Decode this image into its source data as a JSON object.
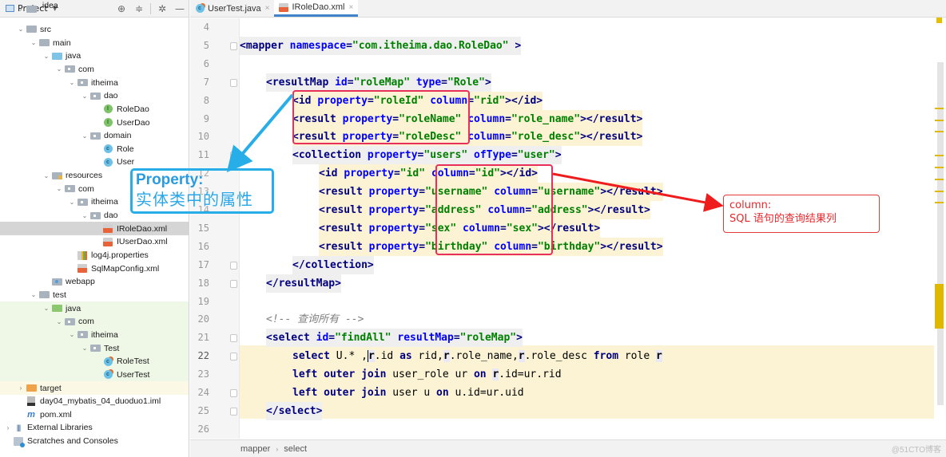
{
  "sidebar": {
    "title": "Project",
    "tools": [
      "locate-icon",
      "collapse-icon",
      "gear-icon",
      "minimize-icon"
    ],
    "tree": [
      {
        "label": ".idea",
        "type": "folder",
        "depth": 1,
        "arrow": "right",
        "partial": true
      },
      {
        "label": "src",
        "type": "folder",
        "depth": 1,
        "arrow": "down"
      },
      {
        "label": "main",
        "type": "folder",
        "depth": 2,
        "arrow": "down"
      },
      {
        "label": "java",
        "type": "src-folder",
        "depth": 3,
        "arrow": "down"
      },
      {
        "label": "com",
        "type": "package",
        "depth": 4,
        "arrow": "down"
      },
      {
        "label": "itheima",
        "type": "package",
        "depth": 5,
        "arrow": "down"
      },
      {
        "label": "dao",
        "type": "package",
        "depth": 6,
        "arrow": "down"
      },
      {
        "label": "RoleDao",
        "type": "interface",
        "depth": 7
      },
      {
        "label": "UserDao",
        "type": "interface",
        "depth": 7
      },
      {
        "label": "domain",
        "type": "package",
        "depth": 6,
        "arrow": "down"
      },
      {
        "label": "Role",
        "type": "class",
        "depth": 7
      },
      {
        "label": "User",
        "type": "class",
        "depth": 7
      },
      {
        "label": "resources",
        "type": "resources-folder",
        "depth": 3,
        "arrow": "down"
      },
      {
        "label": "com",
        "type": "package",
        "depth": 4,
        "arrow": "down"
      },
      {
        "label": "itheima",
        "type": "package",
        "depth": 5,
        "arrow": "down"
      },
      {
        "label": "dao",
        "type": "package",
        "depth": 6,
        "arrow": "down"
      },
      {
        "label": "IRoleDao.xml",
        "type": "xml",
        "depth": 7,
        "selected": true
      },
      {
        "label": "IUserDao.xml",
        "type": "xml",
        "depth": 7
      },
      {
        "label": "log4j.properties",
        "type": "properties",
        "depth": 5
      },
      {
        "label": "SqlMapConfig.xml",
        "type": "xml",
        "depth": 5
      },
      {
        "label": "webapp",
        "type": "web-folder",
        "depth": 3
      },
      {
        "label": "test",
        "type": "folder",
        "depth": 2,
        "arrow": "down"
      },
      {
        "label": "java",
        "type": "test-folder",
        "depth": 3,
        "arrow": "down",
        "bg": "test"
      },
      {
        "label": "com",
        "type": "package",
        "depth": 4,
        "arrow": "down",
        "bg": "test"
      },
      {
        "label": "itheima",
        "type": "package",
        "depth": 5,
        "arrow": "down",
        "bg": "test"
      },
      {
        "label": "Test",
        "type": "package",
        "depth": 6,
        "arrow": "down",
        "bg": "test"
      },
      {
        "label": "RoleTest",
        "type": "test-class",
        "depth": 7,
        "bg": "test"
      },
      {
        "label": "UserTest",
        "type": "test-class",
        "depth": 7,
        "bg": "test"
      },
      {
        "label": "target",
        "type": "target-folder",
        "depth": 1,
        "arrow": "right",
        "bg": "target"
      },
      {
        "label": "day04_mybatis_04_duoduo1.iml",
        "type": "iml",
        "depth": 1
      },
      {
        "label": "pom.xml",
        "type": "pom",
        "depth": 1
      },
      {
        "label": "External Libraries",
        "type": "libraries",
        "depth": 0,
        "arrow": "right"
      },
      {
        "label": "Scratches and Consoles",
        "type": "scratches",
        "depth": 0
      }
    ]
  },
  "tabs": [
    {
      "label": "UserTest.java",
      "icon": "test-class",
      "active": false
    },
    {
      "label": "IRoleDao.xml",
      "icon": "xml",
      "active": true
    }
  ],
  "editor": {
    "current_line": 22,
    "lines": [
      {
        "n": 4,
        "tokens": []
      },
      {
        "n": 5,
        "indent": 0,
        "hl": "tag",
        "fold": true,
        "tokens": [
          [
            "tag",
            "<mapper "
          ],
          [
            "attr",
            "namespace"
          ],
          [
            "tag",
            "="
          ],
          [
            "val",
            "\"com.itheima.dao.RoleDao\""
          ],
          [
            "plain",
            " "
          ],
          [
            "tag",
            ">"
          ]
        ]
      },
      {
        "n": 6,
        "tokens": []
      },
      {
        "n": 7,
        "indent": 1,
        "hl": "tag",
        "fold": true,
        "tokens": [
          [
            "tag",
            "<resultMap "
          ],
          [
            "attr",
            "id"
          ],
          [
            "tag",
            "="
          ],
          [
            "val",
            "\"roleMap\""
          ],
          [
            "plain",
            " "
          ],
          [
            "attr",
            "type"
          ],
          [
            "tag",
            "="
          ],
          [
            "val",
            "\"Role\""
          ],
          [
            "tag",
            ">"
          ]
        ]
      },
      {
        "n": 8,
        "indent": 2,
        "hl": "yellow",
        "tokens": [
          [
            "tag",
            "<id "
          ],
          [
            "attr",
            "property"
          ],
          [
            "tag",
            "="
          ],
          [
            "val",
            "\"roleId\""
          ],
          [
            "plain",
            " "
          ],
          [
            "attr",
            "column"
          ],
          [
            "tag",
            "="
          ],
          [
            "val",
            "\"rid\""
          ],
          [
            "tag",
            "></id>"
          ]
        ]
      },
      {
        "n": 9,
        "indent": 2,
        "hl": "yellow",
        "tokens": [
          [
            "tag",
            "<result "
          ],
          [
            "attr",
            "property"
          ],
          [
            "tag",
            "="
          ],
          [
            "val",
            "\"roleName\""
          ],
          [
            "plain",
            " "
          ],
          [
            "attr",
            "column"
          ],
          [
            "tag",
            "="
          ],
          [
            "val",
            "\"role_name\""
          ],
          [
            "tag",
            "></result>"
          ]
        ]
      },
      {
        "n": 10,
        "indent": 2,
        "hl": "yellow",
        "tokens": [
          [
            "tag",
            "<result "
          ],
          [
            "attr",
            "property"
          ],
          [
            "tag",
            "="
          ],
          [
            "val",
            "\"roleDesc\""
          ],
          [
            "plain",
            " "
          ],
          [
            "attr",
            "column"
          ],
          [
            "tag",
            "="
          ],
          [
            "val",
            "\"role_desc\""
          ],
          [
            "tag",
            "></result>"
          ]
        ]
      },
      {
        "n": 11,
        "indent": 2,
        "hl": "tag",
        "fold": true,
        "tokens": [
          [
            "tag",
            "<collection "
          ],
          [
            "attr",
            "property"
          ],
          [
            "tag",
            "="
          ],
          [
            "val",
            "\"users\""
          ],
          [
            "plain",
            " "
          ],
          [
            "attr",
            "ofType"
          ],
          [
            "tag",
            "="
          ],
          [
            "val",
            "\"user\""
          ],
          [
            "tag",
            ">"
          ]
        ]
      },
      {
        "n": 12,
        "indent": 3,
        "hl": "yellow",
        "tokens": [
          [
            "tag",
            "<id "
          ],
          [
            "attr",
            "property"
          ],
          [
            "tag",
            "="
          ],
          [
            "val",
            "\"id\""
          ],
          [
            "plain",
            " "
          ],
          [
            "attr",
            "column"
          ],
          [
            "tag",
            "="
          ],
          [
            "val",
            "\"id\""
          ],
          [
            "tag",
            "></id>"
          ]
        ]
      },
      {
        "n": 13,
        "indent": 3,
        "hl": "yellow",
        "tokens": [
          [
            "tag",
            "<result "
          ],
          [
            "attr",
            "property"
          ],
          [
            "tag",
            "="
          ],
          [
            "val",
            "\"username\""
          ],
          [
            "plain",
            " "
          ],
          [
            "attr",
            "column"
          ],
          [
            "tag",
            "="
          ],
          [
            "val",
            "\"username\""
          ],
          [
            "tag",
            "></result>"
          ]
        ]
      },
      {
        "n": 14,
        "indent": 3,
        "hl": "yellow",
        "tokens": [
          [
            "tag",
            "<result "
          ],
          [
            "attr",
            "property"
          ],
          [
            "tag",
            "="
          ],
          [
            "val",
            "\"address\""
          ],
          [
            "plain",
            " "
          ],
          [
            "attr",
            "column"
          ],
          [
            "tag",
            "="
          ],
          [
            "val",
            "\"address\""
          ],
          [
            "tag",
            "></result>"
          ]
        ]
      },
      {
        "n": 15,
        "indent": 3,
        "hl": "yellow",
        "tokens": [
          [
            "tag",
            "<result "
          ],
          [
            "attr",
            "property"
          ],
          [
            "tag",
            "="
          ],
          [
            "val",
            "\"sex\""
          ],
          [
            "plain",
            " "
          ],
          [
            "attr",
            "column"
          ],
          [
            "tag",
            "="
          ],
          [
            "val",
            "\"sex\""
          ],
          [
            "tag",
            "></result>"
          ]
        ]
      },
      {
        "n": 16,
        "indent": 3,
        "hl": "yellow",
        "tokens": [
          [
            "tag",
            "<result "
          ],
          [
            "attr",
            "property"
          ],
          [
            "tag",
            "="
          ],
          [
            "val",
            "\"birthday\""
          ],
          [
            "plain",
            " "
          ],
          [
            "attr",
            "column"
          ],
          [
            "tag",
            "="
          ],
          [
            "val",
            "\"birthday\""
          ],
          [
            "tag",
            "></result>"
          ]
        ]
      },
      {
        "n": 17,
        "indent": 2,
        "hl": "tag",
        "fold": true,
        "tokens": [
          [
            "tag",
            "</collection>"
          ]
        ]
      },
      {
        "n": 18,
        "indent": 1,
        "hl": "tag",
        "fold": true,
        "tokens": [
          [
            "tag",
            "</resultMap>"
          ]
        ]
      },
      {
        "n": 19,
        "tokens": []
      },
      {
        "n": 20,
        "indent": 1,
        "tokens": [
          [
            "cmt",
            "<!-- 查询所有 -->"
          ]
        ]
      },
      {
        "n": 21,
        "indent": 1,
        "hl": "tag",
        "fold": true,
        "tokens": [
          [
            "tag",
            "<select "
          ],
          [
            "attr",
            "id"
          ],
          [
            "tag",
            "="
          ],
          [
            "val",
            "\"findAll\""
          ],
          [
            "plain",
            " "
          ],
          [
            "attr",
            "resultMap"
          ],
          [
            "tag",
            "="
          ],
          [
            "val",
            "\"roleMap\""
          ],
          [
            "tag",
            ">"
          ]
        ]
      },
      {
        "n": 22,
        "indent": 2,
        "fold": true,
        "tokens": [
          [
            "kw",
            "select"
          ],
          [
            "sql",
            " U.* ,"
          ],
          [
            "rvar",
            "r"
          ],
          [
            "sql",
            ".id "
          ],
          [
            "kw",
            "as"
          ],
          [
            "sql",
            " rid,"
          ],
          [
            "rvar",
            "r"
          ],
          [
            "sql",
            ".role_name,"
          ],
          [
            "rvar",
            "r"
          ],
          [
            "sql",
            ".role_desc "
          ],
          [
            "kw",
            "from"
          ],
          [
            "sql",
            " role "
          ],
          [
            "rvar",
            "r"
          ]
        ]
      },
      {
        "n": 23,
        "indent": 2,
        "tokens": [
          [
            "kw",
            "left outer join"
          ],
          [
            "sql",
            " user_role ur "
          ],
          [
            "kw",
            "on"
          ],
          [
            "sql",
            " "
          ],
          [
            "rvar",
            "r"
          ],
          [
            "sql",
            ".id=ur.rid"
          ]
        ]
      },
      {
        "n": 24,
        "indent": 2,
        "fold": true,
        "tokens": [
          [
            "kw",
            "left outer join"
          ],
          [
            "sql",
            " user u "
          ],
          [
            "kw",
            "on"
          ],
          [
            "sql",
            " u.id=ur.uid"
          ]
        ]
      },
      {
        "n": 25,
        "indent": 1,
        "hl": "tag",
        "fold": true,
        "tokens": [
          [
            "tag",
            "</select>"
          ]
        ]
      },
      {
        "n": 26,
        "tokens": []
      }
    ]
  },
  "breadcrumb": [
    "mapper",
    "select"
  ],
  "watermark": "@51CTO博客",
  "annotations": {
    "property": {
      "title": "Property:",
      "desc": "实体类中的属性",
      "color": "#27aee8"
    },
    "column": {
      "title": "column:",
      "desc": "SQL 语句的查询结果列",
      "color": "#e23838"
    }
  },
  "colors": {
    "tag": "#000080",
    "attr": "#0000ff",
    "value": "#008000",
    "highlight_yellow": "#fbf3d3",
    "highlight_box": "#e8305a",
    "tab_accent": "#4083c9"
  }
}
